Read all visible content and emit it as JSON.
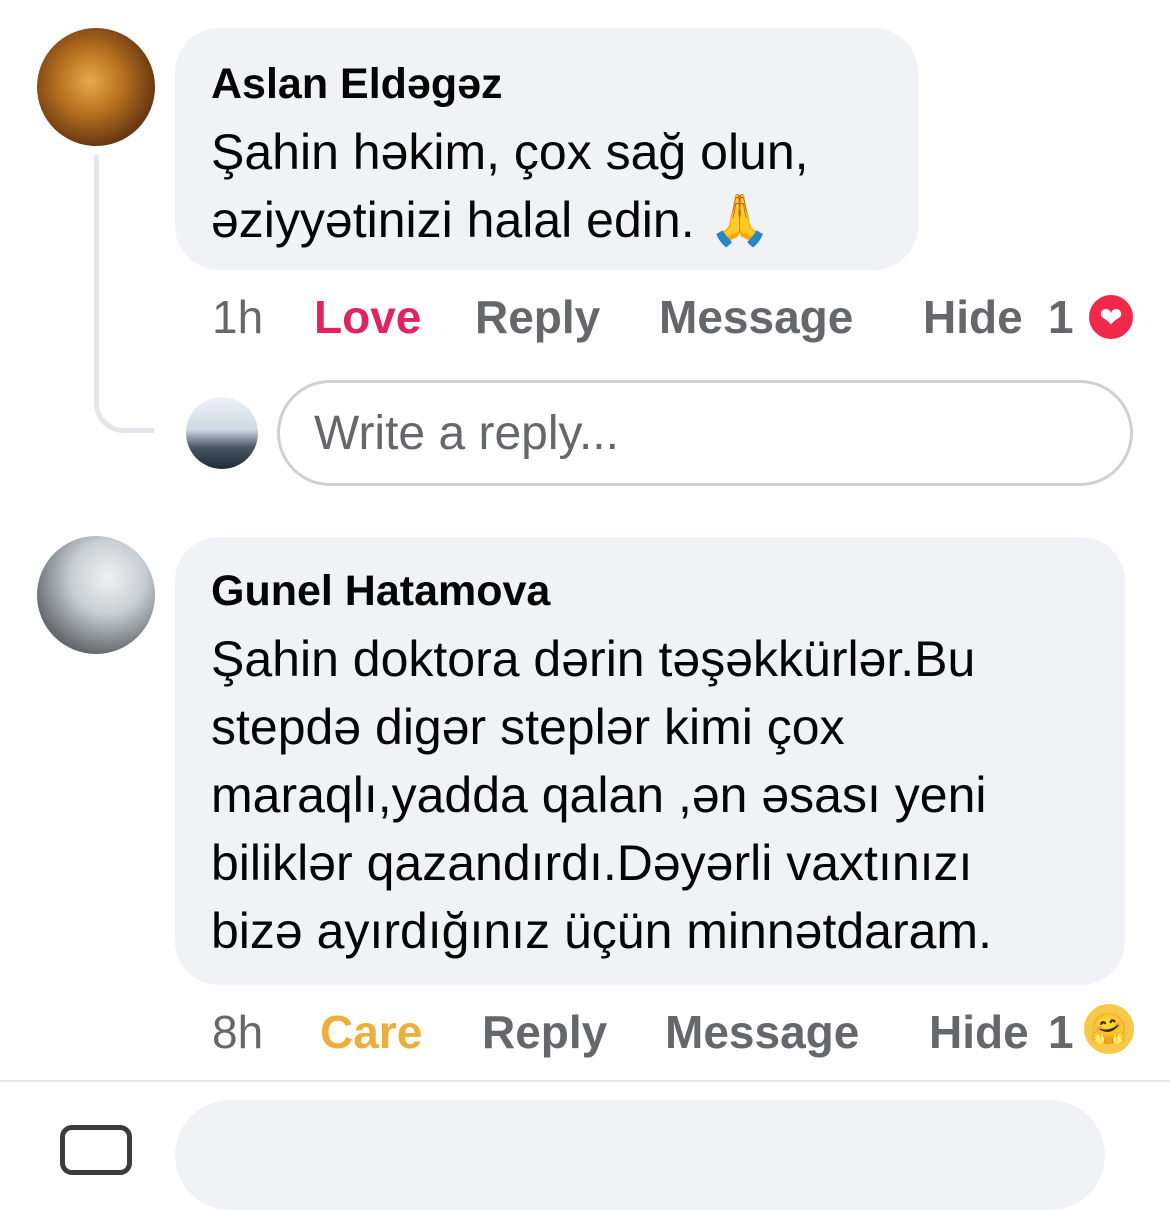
{
  "comments": [
    {
      "author": "Aslan Eldəgəz",
      "text": "Şahin həkim, çox sağ olun,\nəziyyətinizi halal edin. 🙏",
      "time": "1h",
      "reaction": "Love",
      "reply": "Reply",
      "message": "Message",
      "hide": "Hide",
      "reaction_count": "1",
      "reaction_icon": "heart-icon",
      "reaction_icon_glyph": "❤"
    },
    {
      "author": "Gunel Hatamova",
      "text": "Şahin doktora dərin təşəkkürlər.Bu\nstepdə digər steplər kimi çox\nmaraqlı,yadda qalan ,ən əsası yeni\nbiliklər qazandırdı.Dəyərli vaxtınızı\nbizə ayırdığınız üçün minnətdaram.",
      "time": "8h",
      "reaction": "Care",
      "reply": "Reply",
      "message": "Message",
      "hide": "Hide",
      "reaction_count": "1",
      "reaction_icon": "care-emoji-icon",
      "reaction_icon_glyph": "🤗"
    }
  ],
  "reply_box": {
    "placeholder": "Write a reply..."
  },
  "colors": {
    "love": "#e0245e",
    "care": "#e9b03d",
    "bubble": "#f0f2f5",
    "muted": "#65676b"
  }
}
